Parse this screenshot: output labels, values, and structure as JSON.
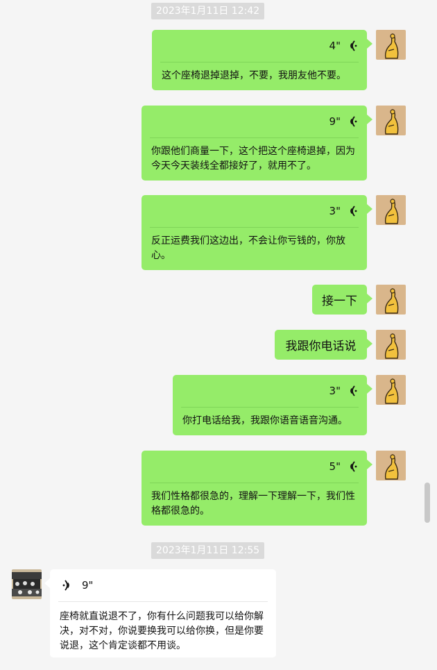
{
  "timestamps": [
    "2023年1月11日 12:42",
    "2023年1月11日 12:55"
  ],
  "messages": [
    {
      "type": "voice",
      "duration": "4\"",
      "transcript": "这个座椅退掉退掉，不要，我朋友他不要。"
    },
    {
      "type": "voice",
      "duration": "9\"",
      "transcript": "你跟他们商量一下，这个把这个座椅退掉，因为今天今天装线全都接好了，就用不了。"
    },
    {
      "type": "voice",
      "duration": "3\"",
      "transcript": "反正运费我们这边出，不会让你亏钱的，你放心。"
    },
    {
      "type": "text",
      "text": "接一下"
    },
    {
      "type": "text",
      "text": "我跟你电话说"
    },
    {
      "type": "voice",
      "duration": "3\"",
      "transcript": "你打电话给我，我跟你语音语音沟通。"
    },
    {
      "type": "voice",
      "duration": "5\"",
      "transcript": "我们性格都很急的，理解一下理解一下，我们性格都很急的。"
    },
    {
      "type": "voice",
      "duration": "9\"",
      "transcript": "座椅就直说退不了，你有什么问题我可以给你解决，对不对，你说要换我可以给你换，但是你要说退，这个肯定谈都不用谈。"
    }
  ],
  "colors": {
    "background": "#f5f5f5",
    "my_bubble": "#95ec69",
    "other_bubble": "#ffffff",
    "timestamp_bg": "#dadada"
  }
}
